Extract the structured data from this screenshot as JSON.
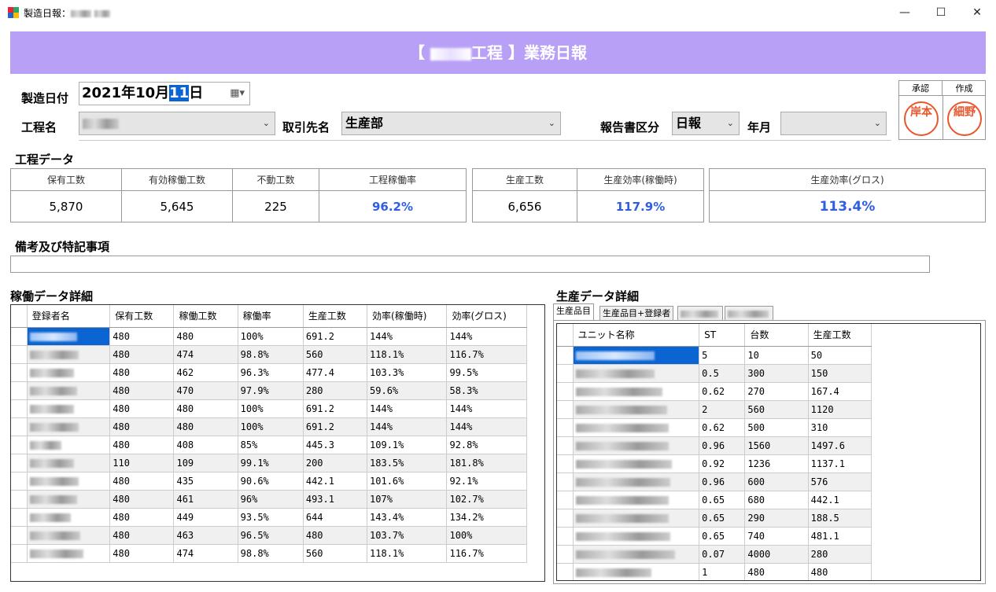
{
  "window": {
    "title": "製造日報：",
    "min": "—",
    "max": "☐",
    "close": "✕"
  },
  "banner": {
    "prefix": "【",
    "suffix": "工程 】業務日報"
  },
  "form": {
    "date_label": "製造日付",
    "date_prefix": "2021年10月",
    "date_selected": "11",
    "date_suffix": "日",
    "process_label": "工程名",
    "customer_label": "取引先名",
    "customer_value": "生産部",
    "report_type_label": "報告書区分",
    "report_type_value": "日報",
    "yearmonth_label": "年月",
    "yearmonth_value": ""
  },
  "stamps": {
    "approve_label": "承認",
    "create_label": "作成",
    "approve_text": "岸本",
    "create_text": "細野"
  },
  "process_data": {
    "title": "工程データ",
    "headers": [
      "保有工数",
      "有効稼働工数",
      "不動工数",
      "工程稼働率",
      "生産工数",
      "生産効率(稼働時)",
      "生産効率(グロス)"
    ],
    "values": [
      "5,870",
      "5,645",
      "225",
      "96.2%",
      "6,656",
      "117.9%",
      "113.4%"
    ]
  },
  "remarks": {
    "title": "備考及び特記事項",
    "value": ""
  },
  "operation_detail": {
    "title": "稼働データ詳細",
    "columns": [
      "登録者名",
      "保有工数",
      "稼働工数",
      "稼働率",
      "生産工数",
      "効率(稼働時)",
      "効率(グロス)"
    ],
    "rows": [
      [
        "",
        "480",
        "480",
        "100%",
        "691.2",
        "144%",
        "144%"
      ],
      [
        "",
        "480",
        "474",
        "98.8%",
        "560",
        "118.1%",
        "116.7%"
      ],
      [
        "",
        "480",
        "462",
        "96.3%",
        "477.4",
        "103.3%",
        "99.5%"
      ],
      [
        "",
        "480",
        "470",
        "97.9%",
        "280",
        "59.6%",
        "58.3%"
      ],
      [
        "",
        "480",
        "480",
        "100%",
        "691.2",
        "144%",
        "144%"
      ],
      [
        "",
        "480",
        "480",
        "100%",
        "691.2",
        "144%",
        "144%"
      ],
      [
        "",
        "480",
        "408",
        "85%",
        "445.3",
        "109.1%",
        "92.8%"
      ],
      [
        "",
        "110",
        "109",
        "99.1%",
        "200",
        "183.5%",
        "181.8%"
      ],
      [
        "",
        "480",
        "435",
        "90.6%",
        "442.1",
        "101.6%",
        "92.1%"
      ],
      [
        "",
        "480",
        "461",
        "96%",
        "493.1",
        "107%",
        "102.7%"
      ],
      [
        "",
        "480",
        "449",
        "93.5%",
        "644",
        "143.4%",
        "134.2%"
      ],
      [
        "",
        "480",
        "463",
        "96.5%",
        "480",
        "103.7%",
        "100%"
      ],
      [
        "",
        "480",
        "474",
        "98.8%",
        "560",
        "118.1%",
        "116.7%"
      ]
    ]
  },
  "production_detail": {
    "title": "生産データ詳細",
    "tabs": [
      "生産品目",
      "生産品目+登録者",
      "",
      ""
    ],
    "columns": [
      "ユニット名称",
      "ST",
      "台数",
      "生産工数"
    ],
    "rows": [
      [
        "",
        "5",
        "10",
        "50"
      ],
      [
        "",
        "0.5",
        "300",
        "150"
      ],
      [
        "",
        "0.62",
        "270",
        "167.4"
      ],
      [
        "",
        "2",
        "560",
        "1120"
      ],
      [
        "",
        "0.62",
        "500",
        "310"
      ],
      [
        "",
        "0.96",
        "1560",
        "1497.6"
      ],
      [
        "",
        "0.92",
        "1236",
        "1137.1"
      ],
      [
        "",
        "0.96",
        "600",
        "576"
      ],
      [
        "",
        "0.65",
        "680",
        "442.1"
      ],
      [
        "",
        "0.65",
        "290",
        "188.5"
      ],
      [
        "",
        "0.65",
        "740",
        "481.1"
      ],
      [
        "",
        "0.07",
        "4000",
        "280"
      ],
      [
        "",
        "1",
        "480",
        "480"
      ]
    ]
  },
  "icons": {
    "app": "app-icon",
    "calendar": "calendar-icon",
    "dropdown": "chevron-down-icon"
  }
}
